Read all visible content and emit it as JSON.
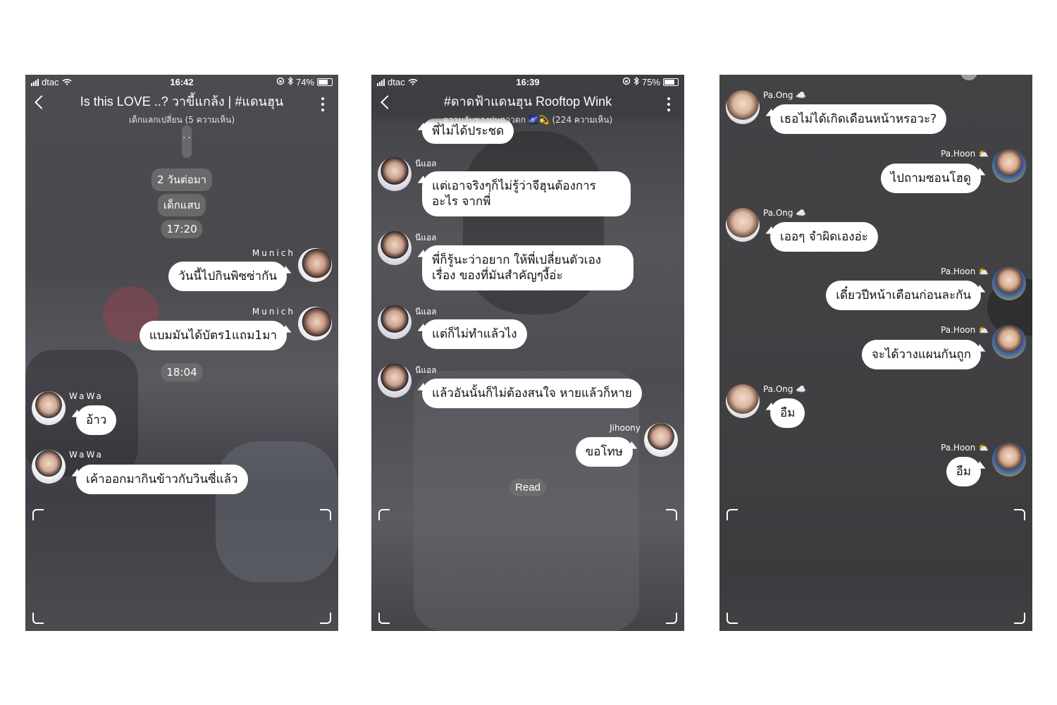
{
  "screens": [
    {
      "status": {
        "carrier": "dtac",
        "time": "16:42",
        "battery": "74%",
        "battery_level": 0.74
      },
      "header": {
        "title": "Is this LOVE ..? วาขี้แกล้ง | #แดนฮุน",
        "subtitle": "เด็กแลกเปลี่ยน (5 ความเห็น)"
      },
      "pills": {
        "dots": ". .",
        "time_label": "2 วันต่อมา",
        "name_label": "เด็กแสบ",
        "t1": "17:20",
        "t2": "18:04"
      },
      "messages": [
        {
          "sender": "Munich",
          "text": "วันนี้ไปกินพิซซ่ากัน"
        },
        {
          "sender": "Munich",
          "text": "แบมมันได้บัตร1แถม1มา"
        },
        {
          "sender": "WaWa",
          "text": "อ้าว"
        },
        {
          "sender": "WaWa",
          "text": "เค้าออกมากินข้าวกับวินซี่แล้ว"
        }
      ]
    },
    {
      "status": {
        "carrier": "dtac",
        "time": "16:39",
        "battery": "75%",
        "battery_level": 0.75
      },
      "header": {
        "title": "#ดาดฟ้าแดนฮุน  Rooftop Wink",
        "subtitle": "ความลับของฝนดาวตก 🌌💫 (224 ความเห็น)"
      },
      "messages": [
        {
          "sender": "",
          "text": "พี่ไม่ได้ประชด"
        },
        {
          "sender": "นีแอล",
          "text": "แต่เอาจริงๆก็ไม่รู้ว่าจีฮุนต้องการอะไร จากพี่"
        },
        {
          "sender": "นีแอล",
          "text": "พี่ก็รู้นะว่าอยาก ให้พี่เปลี่ยนตัวเองเรื่อง ของที่มันสำคัญๆงี้อ่ะ"
        },
        {
          "sender": "นีแอล",
          "text": "แต่ก็ไม่ทำแล้วไง"
        },
        {
          "sender": "นีแอล",
          "text": "แล้วอันนั้นก็ไม่ต้องสนใจ หายแล้วก็หาย"
        },
        {
          "sender": "Jihoony",
          "text": "ขอโทษ"
        }
      ],
      "read_label": "Read"
    },
    {
      "messages": [
        {
          "sender": "Pa.Ong ☁️",
          "text": "เธอไม่ได้เกิดเดือนหน้าหรอวะ?"
        },
        {
          "sender": "Pa.Hoon ⛅",
          "text": "ไปถามซอนโฮดู"
        },
        {
          "sender": "Pa.Ong ☁️",
          "text": "เออๆ จำผิดเองอ่ะ"
        },
        {
          "sender": "Pa.Hoon ⛅",
          "text": "เดี๋ยวปีหน้าเตือนก่อนละกัน"
        },
        {
          "sender": "Pa.Hoon ⛅",
          "text": "จะได้วางแผนกันถูก"
        },
        {
          "sender": "Pa.Ong ☁️",
          "text": "อืม"
        },
        {
          "sender": "Pa.Hoon ⛅",
          "text": "อืม"
        }
      ]
    }
  ],
  "icons": {
    "back": "back-chevron-icon",
    "menu": "more-vertical-icon",
    "wifi": "wifi-icon",
    "bluetooth": "bluetooth-icon",
    "lock": "rotation-lock-icon",
    "battery": "battery-icon",
    "signal": "signal-bars-icon"
  },
  "colors": {
    "bubble": "#ffffff",
    "pill": "#6e6e70",
    "text": "#111111"
  }
}
